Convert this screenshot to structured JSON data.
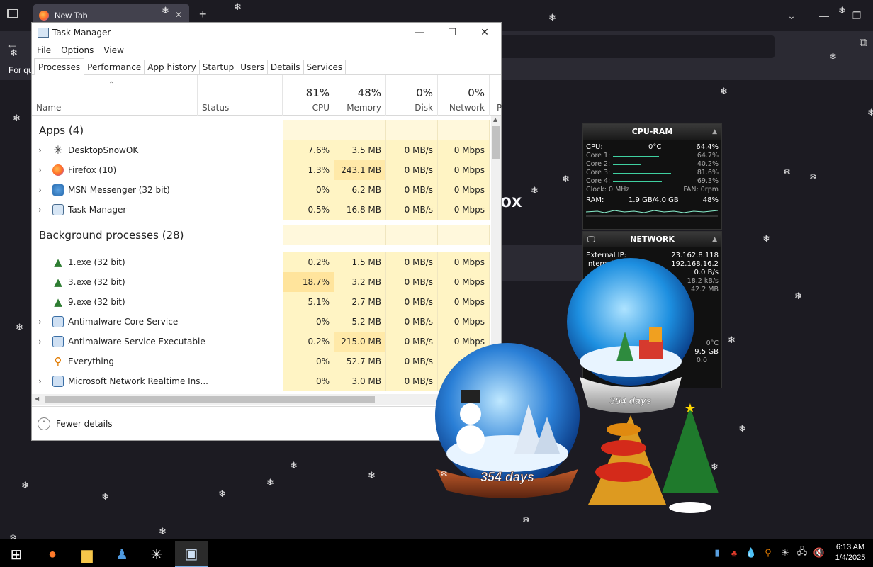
{
  "firefox": {
    "tab_title": "New Tab",
    "bookmarks_text": "For qu",
    "brand_text": "ox"
  },
  "task_manager": {
    "title": "Task Manager",
    "menu": [
      "File",
      "Options",
      "View"
    ],
    "tabs": [
      "Processes",
      "Performance",
      "App history",
      "Startup",
      "Users",
      "Details",
      "Services"
    ],
    "columns": {
      "name": "Name",
      "status": "Status",
      "cpu_pct": "81%",
      "cpu": "CPU",
      "mem_pct": "48%",
      "mem": "Memory",
      "disk_pct": "0%",
      "disk": "Disk",
      "net_pct": "0%",
      "net": "Network",
      "power_partial": "P"
    },
    "groups": {
      "apps": "Apps (4)",
      "background": "Background processes (28)"
    },
    "apps": [
      {
        "name": "DesktopSnowOK",
        "cpu": "7.6%",
        "mem": "3.5 MB",
        "disk": "0 MB/s",
        "net": "0 Mbps",
        "icon": "snowflake-icon"
      },
      {
        "name": "Firefox (10)",
        "cpu": "1.3%",
        "mem": "243.1 MB",
        "disk": "0 MB/s",
        "net": "0 Mbps",
        "icon": "firefox-icon"
      },
      {
        "name": "MSN Messenger (32 bit)",
        "cpu": "0%",
        "mem": "6.2 MB",
        "disk": "0 MB/s",
        "net": "0 Mbps",
        "icon": "msn-icon"
      },
      {
        "name": "Task Manager",
        "cpu": "0.5%",
        "mem": "16.8 MB",
        "disk": "0 MB/s",
        "net": "0 Mbps",
        "icon": "task-manager-icon"
      }
    ],
    "background": [
      {
        "name": "1.exe (32 bit)",
        "cpu": "0.2%",
        "mem": "1.5 MB",
        "disk": "0 MB/s",
        "net": "0 Mbps",
        "icon": "tree-icon"
      },
      {
        "name": "3.exe (32 bit)",
        "cpu": "18.7%",
        "mem": "3.2 MB",
        "disk": "0 MB/s",
        "net": "0 Mbps",
        "icon": "tree-icon"
      },
      {
        "name": "9.exe (32 bit)",
        "cpu": "5.1%",
        "mem": "2.7 MB",
        "disk": "0 MB/s",
        "net": "0 Mbps",
        "icon": "tree-icon"
      },
      {
        "name": "Antimalware Core Service",
        "cpu": "0%",
        "mem": "5.2 MB",
        "disk": "0 MB/s",
        "net": "0 Mbps",
        "icon": "service-window-icon"
      },
      {
        "name": "Antimalware Service Executable",
        "cpu": "0.2%",
        "mem": "215.0 MB",
        "disk": "0 MB/s",
        "net": "0 Mbps",
        "icon": "service-window-icon"
      },
      {
        "name": "Everything",
        "cpu": "0%",
        "mem": "52.7 MB",
        "disk": "0 MB/s",
        "net": "0",
        "icon": "magnifier-icon"
      },
      {
        "name": "Microsoft Network Realtime Ins...",
        "cpu": "0%",
        "mem": "3.0 MB",
        "disk": "0 MB/s",
        "net": "",
        "icon": "service-window-icon"
      }
    ],
    "fewer_details": "Fewer details"
  },
  "cpu_ram_gadget": {
    "title": "CPU-RAM",
    "cpu_label": "CPU:",
    "temp": "0°C",
    "cpu_value": "64.4%",
    "cores": [
      {
        "label": "Core 1:",
        "value": "64.7%",
        "level": 0.647
      },
      {
        "label": "Core 2:",
        "value": "40.2%",
        "level": 0.402
      },
      {
        "label": "Core 3:",
        "value": "81.6%",
        "level": 0.816
      },
      {
        "label": "Core 4:",
        "value": "69.3%",
        "level": 0.693
      }
    ],
    "clock": "Clock: 0 MHz",
    "fan": "FAN: 0rpm",
    "ram_label": "RAM:",
    "ram_value": "1.9 GB/4.0 GB",
    "ram_pct": "48%"
  },
  "network_gadget": {
    "title": "NETWORK",
    "external_label": "External IP:",
    "external_ip": "23.162.8.118",
    "internal_label": "Internal",
    "internal_ip": "192.168.16.2",
    "rate1": "0.0 B/s",
    "rate2": "18.2 kB/s",
    "rate3": "42.2 MB",
    "temp2": "0°C",
    "size2": "9.5 GB",
    "small": "0.0"
  },
  "globes": {
    "front_label": "354 days",
    "back_label": "354 days"
  },
  "taskbar": {
    "time": "6:13 AM",
    "date": "1/4/2025",
    "apps": [
      "firefox-icon",
      "file-explorer-icon",
      "msn-icon",
      "snowflake-icon",
      "task-manager-icon"
    ]
  }
}
